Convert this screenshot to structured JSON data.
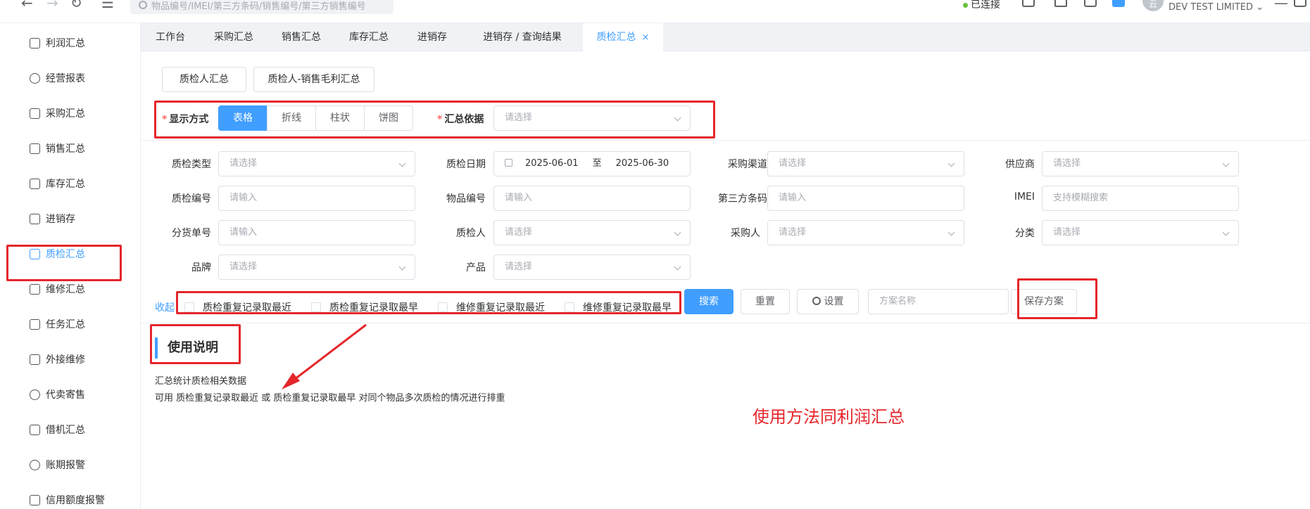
{
  "topbar": {
    "search_placeholder": "物品编号/IMEI/第三方条码/销售编号/第三方销售编号",
    "status": "已连接",
    "avatar_text": "云",
    "company": "DEV TEST LIMITED"
  },
  "sidebar": {
    "items": [
      {
        "label": "利润汇总",
        "icon": "report-icon"
      },
      {
        "label": "经营报表",
        "icon": "chart-icon"
      },
      {
        "label": "采购汇总",
        "icon": "cart-icon"
      },
      {
        "label": "销售汇总",
        "icon": "shop-icon"
      },
      {
        "label": "库存汇总",
        "icon": "warehouse-icon"
      },
      {
        "label": "进销存",
        "icon": "inventory-icon"
      },
      {
        "label": "质检汇总",
        "icon": "inspection-icon"
      },
      {
        "label": "维修汇总",
        "icon": "repair-icon"
      },
      {
        "label": "任务汇总",
        "icon": "task-icon"
      },
      {
        "label": "外接维修",
        "icon": "tools-icon"
      },
      {
        "label": "代卖寄售",
        "icon": "consign-icon"
      },
      {
        "label": "借机汇总",
        "icon": "borrow-icon"
      },
      {
        "label": "账期报警",
        "icon": "alarm-icon"
      },
      {
        "label": "信用额度报警",
        "icon": "credit-icon"
      }
    ]
  },
  "tabs": [
    {
      "label": "工作台"
    },
    {
      "label": "采购汇总"
    },
    {
      "label": "销售汇总"
    },
    {
      "label": "库存汇总"
    },
    {
      "label": "进销存"
    },
    {
      "label": "进销存 / 查询结果"
    },
    {
      "label": "质检汇总",
      "close": "×"
    }
  ],
  "subtabs": [
    "质检人汇总",
    "质检人-销售毛利汇总"
  ],
  "display": {
    "label": "显示方式",
    "required_mark": "*",
    "options": [
      "表格",
      "折线",
      "柱状",
      "饼图"
    ],
    "selected": "表格"
  },
  "summary_basis": {
    "label": "汇总依据",
    "required_mark": "*",
    "placeholder": "请选择"
  },
  "filters": {
    "row1": {
      "qc_type": {
        "label": "质检类型",
        "placeholder": "请选择"
      },
      "qc_date": {
        "label": "质检日期",
        "start": "2025-06-01",
        "sep": "至",
        "end": "2025-06-30"
      },
      "purchase_channel": {
        "label": "采购渠道",
        "placeholder": "请选择"
      },
      "supplier": {
        "label": "供应商",
        "placeholder": "请选择"
      }
    },
    "row2": {
      "qc_no": {
        "label": "质检编号",
        "placeholder": "请输入"
      },
      "item_no": {
        "label": "物品编号",
        "placeholder": "请输入"
      },
      "third_barcode": {
        "label": "第三方条码",
        "placeholder": "请输入"
      },
      "imei": {
        "label": "IMEI",
        "placeholder": "支持模糊搜索"
      }
    },
    "row3": {
      "split_no": {
        "label": "分货单号",
        "placeholder": "请输入"
      },
      "inspector": {
        "label": "质检人",
        "placeholder": "请选择"
      },
      "purchaser": {
        "label": "采购人",
        "placeholder": "请选择"
      },
      "category": {
        "label": "分类",
        "placeholder": "请选择"
      }
    },
    "row4": {
      "brand": {
        "label": "品牌",
        "placeholder": "请选择"
      },
      "product": {
        "label": "产品",
        "placeholder": "请选择"
      }
    }
  },
  "actions": {
    "collapse": "收起",
    "checkboxes": [
      "质检重复记录取最近",
      "质检重复记录取最早",
      "维修重复记录取最近",
      "维修重复记录取最早"
    ],
    "search": "搜索",
    "reset": "重置",
    "settings": "设置",
    "scheme_placeholder": "方案名称",
    "save_scheme": "保存方案"
  },
  "usage": {
    "title": "使用说明",
    "line1": "汇总统计质检相关数据",
    "line2": "可用 质检重复记录取最近 或 质检重复记录取最早 对同个物品多次质检的情况进行排重"
  },
  "annotation": "使用方法同利润汇总",
  "colors": {
    "primary": "#409eff",
    "annotation_red": "#e5262b"
  }
}
